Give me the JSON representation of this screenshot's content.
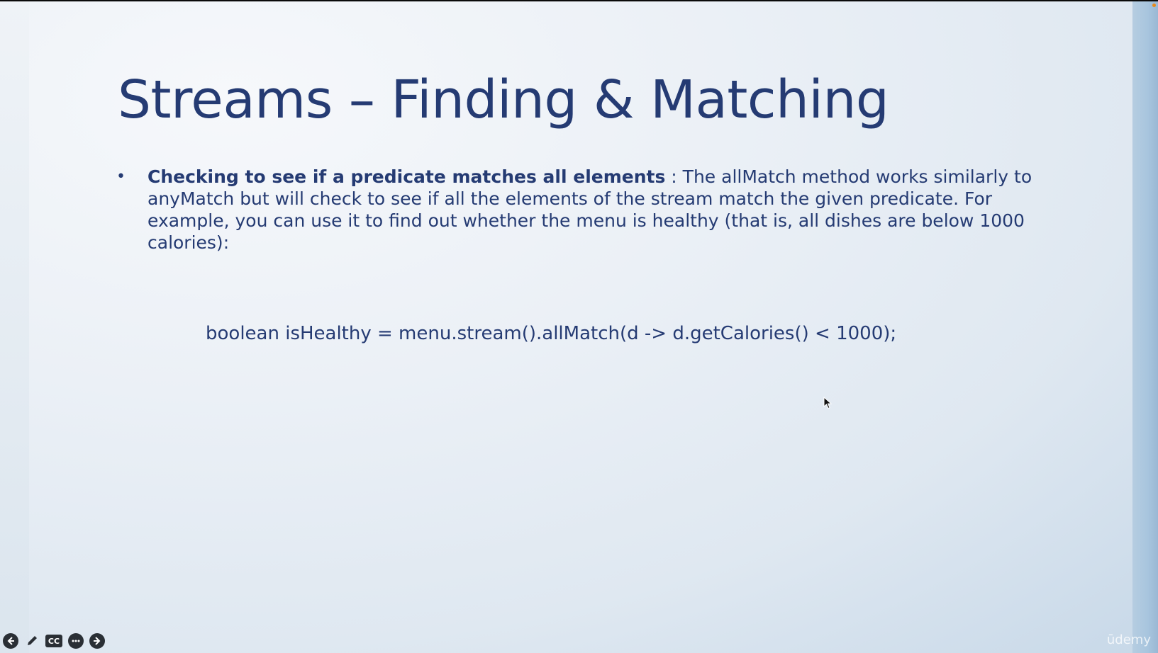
{
  "slide": {
    "title": "Streams – Finding & Matching",
    "bullet": {
      "marker": "•",
      "bold_text": "Checking to see if a predicate matches all elements",
      "body_text": " : The allMatch method works similarly to anyMatch but will check to see if all the elements of the stream match the given predicate. For example, you can use it to find out whether the menu is healthy (that is, all dishes are below 1000 calories):"
    },
    "code": "boolean isHealthy = menu.stream().allMatch(d -> d.getCalories() < 1000);"
  },
  "player": {
    "controls": {
      "prev_icon": "arrow-left-icon",
      "pen_icon": "pen-icon",
      "cc_label": "CC",
      "more_icon": "more-icon",
      "next_icon": "arrow-right-icon"
    },
    "watermark": "ūdemy"
  },
  "colors": {
    "title_text": "#253b73",
    "body_text": "#253b73",
    "background_light": "#eef2f6",
    "background_edge": "#a8c5de"
  }
}
